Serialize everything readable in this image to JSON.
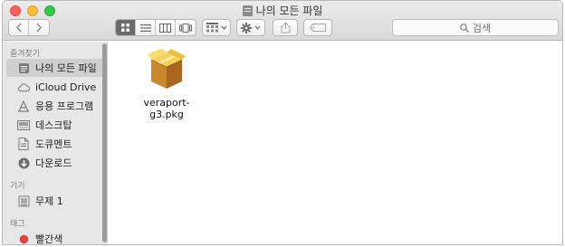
{
  "window": {
    "title": "나의 모든 파일"
  },
  "toolbar": {
    "back_icon": "chevron-left-icon",
    "forward_icon": "chevron-right-icon",
    "view_modes": [
      "icon-view",
      "list-view",
      "column-view",
      "cover-flow-view"
    ],
    "active_view": "icon-view",
    "arrange_icon": "group-grid-icon",
    "action_icon": "gear-icon",
    "share_icon": "share-icon",
    "tag_icon": "tag-icon",
    "search_placeholder": "검색"
  },
  "sidebar": {
    "favorites_label": "즐겨찾기",
    "favorites": [
      {
        "label": "나의 모든 파일",
        "icon": "all-files-icon",
        "selected": true
      },
      {
        "label": "iCloud Drive",
        "icon": "cloud-icon",
        "selected": false
      },
      {
        "label": "응용 프로그램",
        "icon": "applications-icon",
        "selected": false
      },
      {
        "label": "데스크탑",
        "icon": "desktop-icon",
        "selected": false
      },
      {
        "label": "도큐멘트",
        "icon": "documents-icon",
        "selected": false
      },
      {
        "label": "다운로드",
        "icon": "downloads-icon",
        "selected": false
      }
    ],
    "devices_label": "기기",
    "devices": [
      {
        "label": "무제 1",
        "icon": "disk-icon"
      }
    ],
    "tags_label": "태그",
    "tags": [
      {
        "label": "빨간색",
        "color": "#e0443e"
      }
    ]
  },
  "content": {
    "files": [
      {
        "name": "veraport-g3.pkg",
        "icon": "package-icon"
      }
    ]
  },
  "colors": {
    "selection": "#cfcfcf",
    "sidebar_bg": "#e7e7e7",
    "tag_red": "#e0443e"
  }
}
